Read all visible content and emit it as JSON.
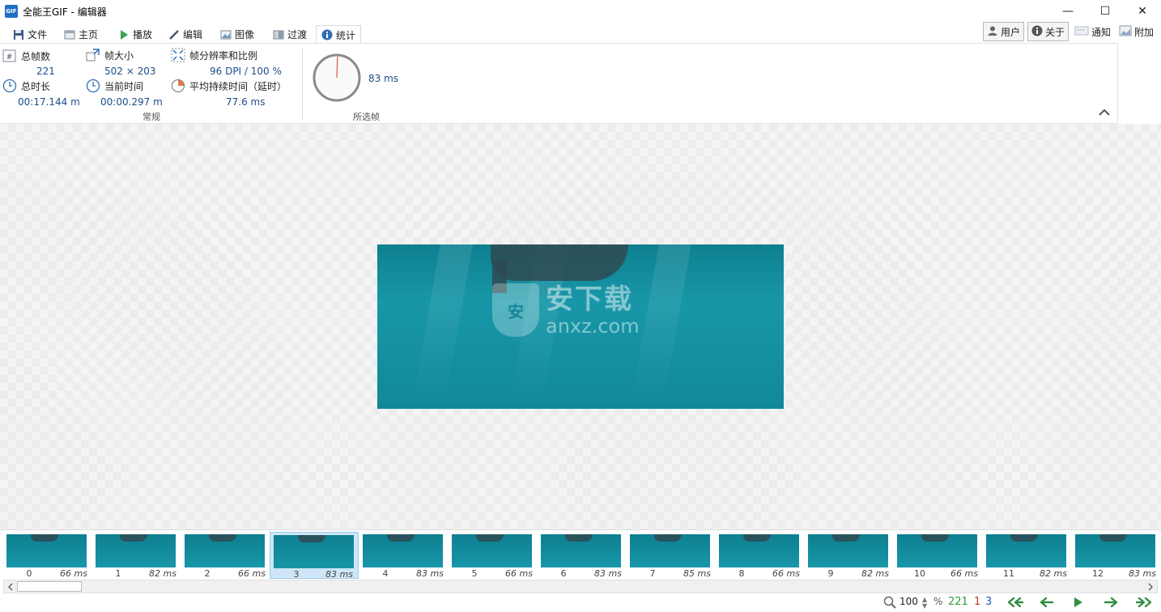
{
  "window": {
    "app_icon": "GIF",
    "title": "全能王GIF - 编辑器",
    "minimize": "—",
    "maximize": "☐",
    "close": "✕"
  },
  "tabs": [
    {
      "label": "文件",
      "icon": "save-icon"
    },
    {
      "label": "主页",
      "icon": "home-icon"
    },
    {
      "label": "播放",
      "icon": "play-icon"
    },
    {
      "label": "编辑",
      "icon": "pencil-icon"
    },
    {
      "label": "图像",
      "icon": "image-icon"
    },
    {
      "label": "过渡",
      "icon": "transition-icon"
    },
    {
      "label": "统计",
      "icon": "info-icon",
      "active": true
    }
  ],
  "right_buttons": {
    "user": "用户",
    "about": "关于",
    "notify": "通知",
    "addon": "附加"
  },
  "stats": {
    "total_frames_label": "总帧数",
    "total_frames_value": "221",
    "frame_size_label": "帧大小",
    "frame_size_value": "502 × 203",
    "resolution_label": "帧分辨率和比例",
    "resolution_value": "96 DPI / 100 %",
    "total_duration_label": "总时长",
    "total_duration_value": "00:17.144 m",
    "current_time_label": "当前时间",
    "current_time_value": "00:00.297 m",
    "avg_duration_label": "平均持续时间（延时）",
    "avg_duration_value": "77.6 ms",
    "group_general": "常规",
    "selected_frame_value": "83 ms",
    "group_selected": "所选帧"
  },
  "watermark": {
    "shield_char": "安",
    "cn": "安下载",
    "en": "anxz.com"
  },
  "frames": [
    {
      "num": "0",
      "ms": "66 ms"
    },
    {
      "num": "1",
      "ms": "82 ms"
    },
    {
      "num": "2",
      "ms": "66 ms"
    },
    {
      "num": "3",
      "ms": "83 ms",
      "selected": true
    },
    {
      "num": "4",
      "ms": "83 ms"
    },
    {
      "num": "5",
      "ms": "66 ms"
    },
    {
      "num": "6",
      "ms": "83 ms"
    },
    {
      "num": "7",
      "ms": "85 ms"
    },
    {
      "num": "8",
      "ms": "66 ms"
    },
    {
      "num": "9",
      "ms": "82 ms"
    },
    {
      "num": "10",
      "ms": "66 ms"
    },
    {
      "num": "11",
      "ms": "82 ms"
    },
    {
      "num": "12",
      "ms": "83 ms"
    }
  ],
  "statusbar": {
    "zoom": "100",
    "zoom_unit": "%",
    "frame_count": "221",
    "selected_count": "1",
    "current_index": "3",
    "colors": {
      "count": "#2a9d3a",
      "selected": "#c0392b",
      "index": "#1f5fbf",
      "nav": "#2f8f3f"
    }
  }
}
